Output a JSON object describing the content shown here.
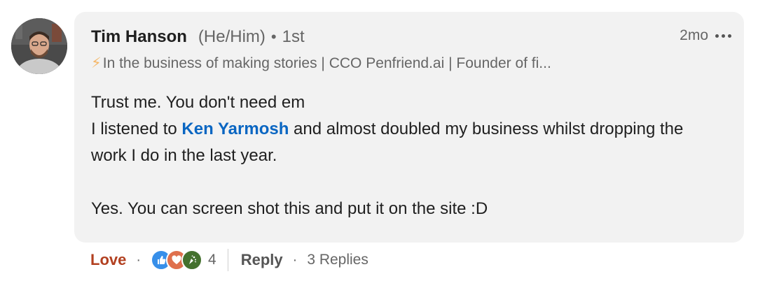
{
  "comment": {
    "author": {
      "name": "Tim Hanson",
      "pronouns": "(He/Him)",
      "separator": "•",
      "degree": "1st",
      "headline_icon": "lightning-bolt-icon",
      "headline": "In the business of making stories | CCO Penfriend.ai | Founder of fi..."
    },
    "timestamp": "2mo",
    "more_icon": "ellipsis-icon",
    "body": {
      "line1": "Trust me. You don't need em",
      "line2_before": "I listened to ",
      "mention": "Ken Yarmosh",
      "line2_after": " and almost doubled my business whilst dropping the work I do in the last year.",
      "line3": "Yes. You can screen shot this and put it on the site :D"
    }
  },
  "actions": {
    "reaction_label": "Love",
    "dot": "·",
    "reaction_icons": [
      "like-icon",
      "love-icon",
      "celebrate-icon"
    ],
    "reaction_count": "4",
    "reply_label": "Reply",
    "replies_label": "3 Replies"
  },
  "colors": {
    "mention": "#0a66c2",
    "love": "#b24020",
    "bubble_bg": "#f2f2f2",
    "like": "#378fe9",
    "heart": "#df704d",
    "celebrate": "#44712e"
  }
}
